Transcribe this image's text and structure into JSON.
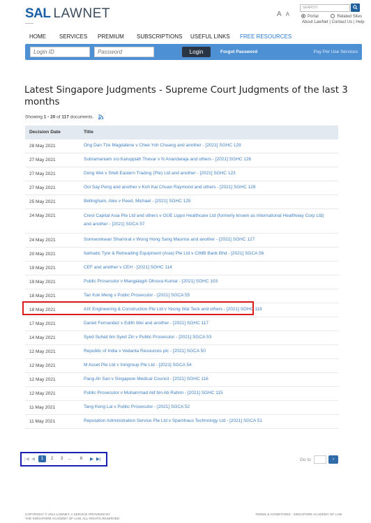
{
  "header": {
    "logo_sal": "SAL",
    "logo_lawnet": "LAWNET",
    "font_size_large": "A",
    "font_size_small": "A",
    "search_placeholder": "SEARCH",
    "search_button_icon": "search-icon",
    "radio_portal": "Portal",
    "radio_related": "Related Sites",
    "link_about": "About LawNet",
    "link_contact": "Contact Us",
    "link_help": "Help"
  },
  "nav": {
    "items": [
      "HOME",
      "SERVICES",
      "PREMIUM",
      "SUBSCRIPTIONS",
      "USEFUL LINKS",
      "FREE RESOURCES"
    ]
  },
  "login": {
    "login_id_placeholder": "Login ID",
    "password_placeholder": "Password",
    "login_button": "Login",
    "forgot_password": "Forgot Password",
    "pay_per_use": "Pay Per Use Services"
  },
  "page": {
    "title": "Latest Singapore Judgments - Supreme Court Judgments of the last 3 months",
    "showing_prefix": "Showing ",
    "showing_range": "1 - 20",
    "showing_of": " of ",
    "showing_total": "117",
    "showing_suffix": " documents."
  },
  "table": {
    "headers": [
      "Decision Date",
      "Title"
    ],
    "rows": [
      {
        "date": "28 May 2021",
        "title": "Ong Dan Tze Magdalene v Chee Yoh Chuang and another - [2021] SGHC 129"
      },
      {
        "date": "27 May 2021",
        "title": "Subramaniam s/o Karuppiah Thevar v N Anandaraja and others - [2021] SGHC 126"
      },
      {
        "date": "27 May 2021",
        "title": "Dong Wei v Shell Eastern Trading (Pte) Ltd and another - [2021] SGHC 123"
      },
      {
        "date": "27 May 2021",
        "title": "Ooi Say Peng and another v Koh Kai Chuan Raymond and others - [2021] SGHC 128"
      },
      {
        "date": "25 May 2021",
        "title": "Bellingham, Alex v Reed, Michael - [2021] SGHC 125"
      },
      {
        "date": "24 May 2021",
        "title": "Crest Capital Asia Pte Ltd and others v OUE Lippo Healthcare Ltd (formerly known as International Healthway Corp Ltd) and another - [2021] SGCA 57"
      },
      {
        "date": "24 May 2021",
        "title": "Somwonkwan Sharinrat v Wong Hong Sang Maurice and another - [2021] SGHC 127"
      },
      {
        "date": "20 May 2021",
        "title": "Italmatic Tyre & Retreading Equipment (Asia) Pte Ltd v CIMB Bank Bhd - [2021] SGCA 56"
      },
      {
        "date": "19 May 2021",
        "title": "CEF and another v CEH - [2021] SGHC 114"
      },
      {
        "date": "19 May 2021",
        "title": "Public Prosecutor v Mangalagiri Dhruva Kumar - [2021] SGHC 103"
      },
      {
        "date": "18 May 2021",
        "title": "Tan Kok Meng v Public Prosecutor - [2021] SGCA 55"
      },
      {
        "date": "18 May 2021",
        "title": "AIX Engineering & Construction Pte Ltd v Yeong Wai Teck and others - [2021] SGHC 118"
      },
      {
        "date": "17 May 2021",
        "title": "Daniel Fernandez v Edith Wei and another - [2021] SGHC 117"
      },
      {
        "date": "14 May 2021",
        "title": "Syed Suhail bin Syed Zin v Public Prosecutor - [2021] SGCA 53"
      },
      {
        "date": "12 May 2021",
        "title": "Republic of India v Vedanta Resources plc - [2021] SGCA 50"
      },
      {
        "date": "12 May 2021",
        "title": "M Asset Pte Ltd v Iningroup Pte Ltd - [2021] SGCA 54"
      },
      {
        "date": "12 May 2021",
        "title": "Pang Ah San v Singapore Medical Council - [2021] SGHC 116"
      },
      {
        "date": "12 May 2021",
        "title": "Public Prosecutor v Muhammad Aiif bin Ab Rahim - [2021] SGHC 115"
      },
      {
        "date": "11 May 2021",
        "title": "Tang Keng Lai v Public Prosecutor - [2021] SGCA 52"
      },
      {
        "date": "11 May 2021",
        "title": "Reputation Administration Service Pte Ltd v Spamhaus Technology Ltd - [2021] SGCA 51"
      }
    ]
  },
  "pager": {
    "first": "|◀",
    "prev": "◀",
    "pages": [
      "1",
      "2",
      "3"
    ],
    "ellipsis": "...",
    "last_page": "6",
    "next": "▶",
    "last": "▶|",
    "goto_label": "Go to",
    "goto_button": "›"
  },
  "footer": {
    "copyright_line1": "COPYRIGHT © 2021 LAWNET. A SERVICE PROVIDED BY",
    "copyright_line2": "THE SINGAPORE ACADEMY OF LAW. ALL RIGHTS RESERVED",
    "right_links": "TERMS & CONDITIONS  -  SINGAPORE ACADEMY OF LAW"
  },
  "colors": {
    "brand_blue": "#1a5ea6",
    "login_bar": "#4e90d4",
    "link": "#3f7fc4",
    "highlight_red": "#dd1b1b",
    "pager_outline": "#1a1fb3"
  }
}
